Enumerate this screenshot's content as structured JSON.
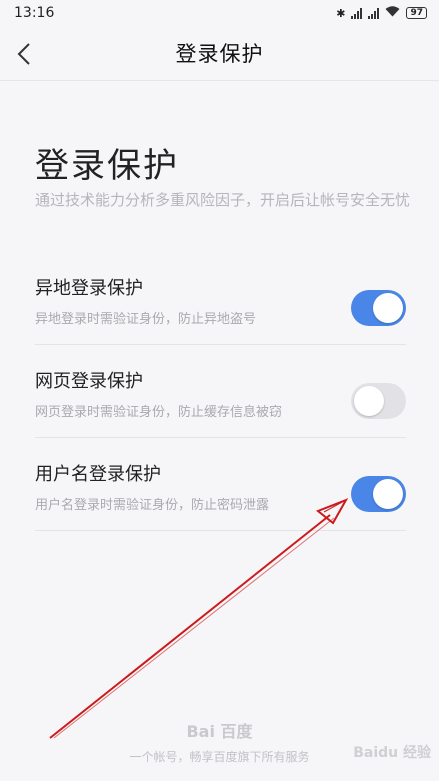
{
  "status_bar": {
    "time": "13:16",
    "battery": "97",
    "icons": [
      "bluetooth-icon",
      "signal-icon",
      "signal-icon",
      "wifi-icon",
      "battery-icon"
    ]
  },
  "header": {
    "title": "登录保护",
    "back_icon": "chevron-left-icon"
  },
  "main": {
    "title": "登录保护",
    "description": "通过技术能力分析多重风险因子，开启后让帐号安全无忧",
    "settings": [
      {
        "title": "异地登录保护",
        "subtitle": "异地登录时需验证身份，防止异地盗号",
        "enabled": true
      },
      {
        "title": "网页登录保护",
        "subtitle": "网页登录时需验证身份，防止缓存信息被窃",
        "enabled": false
      },
      {
        "title": "用户名登录保护",
        "subtitle": "用户名登录时需验证身份，防止密码泄露",
        "enabled": true
      }
    ]
  },
  "footer": {
    "logo_text": "Bai 百度",
    "text": "一个帐号，畅享百度旗下所有服务",
    "watermark": "Baidu 经验"
  },
  "colors": {
    "accent": "#4a86e8",
    "toggle_off": "#e2e2e6",
    "annotation_arrow": "#cc1a1a"
  }
}
